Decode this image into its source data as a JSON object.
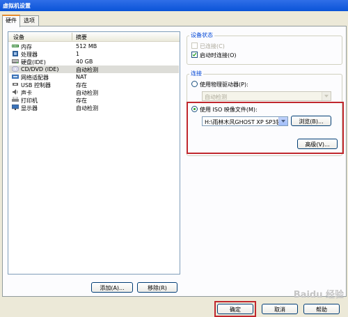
{
  "window": {
    "title": "虚拟机设置"
  },
  "tabs": [
    {
      "label": "硬件",
      "active": true
    },
    {
      "label": "选项",
      "active": false
    }
  ],
  "device_table": {
    "columns": [
      "设备",
      "摘要"
    ],
    "rows": [
      {
        "icon": "memory-icon",
        "name": "内存",
        "summary": "512 MB",
        "selected": false
      },
      {
        "icon": "processor-icon",
        "name": "处理器",
        "summary": "1",
        "selected": false
      },
      {
        "icon": "hard-disk-icon",
        "name": "硬盘(IDE)",
        "summary": "40 GB",
        "selected": false
      },
      {
        "icon": "cd-dvd-icon",
        "name": "CD/DVD (IDE)",
        "summary": "自动检测",
        "selected": true
      },
      {
        "icon": "network-adapter-icon",
        "name": "网络适配器",
        "summary": "NAT",
        "selected": false
      },
      {
        "icon": "usb-icon",
        "name": "USB 控制器",
        "summary": "存在",
        "selected": false
      },
      {
        "icon": "sound-card-icon",
        "name": "声卡",
        "summary": "自动检测",
        "selected": false
      },
      {
        "icon": "printer-icon",
        "name": "打印机",
        "summary": "存在",
        "selected": false
      },
      {
        "icon": "display-icon",
        "name": "显示器",
        "summary": "自动检测",
        "selected": false
      }
    ]
  },
  "list_buttons": {
    "add": "添加(A)...",
    "remove": "移除(R)"
  },
  "device_status": {
    "title": "设备状态",
    "connected": {
      "label": "已连接(C)",
      "checked": false,
      "enabled": false
    },
    "connect_at_power_on": {
      "label": "启动时连接(O)",
      "checked": true,
      "enabled": true
    }
  },
  "connection": {
    "title": "连接",
    "physical_drive": {
      "label": "使用物理驱动器(P):",
      "selected": false,
      "value": "自动检测"
    },
    "iso_image": {
      "label": "使用 ISO 映像文件(M):",
      "selected": true,
      "value": "H:\\雨林木风GHOST XP SP3装"
    },
    "browse": "浏览(B)...",
    "advanced": "高级(V)..."
  },
  "dialog_buttons": {
    "ok": "确定",
    "cancel": "取消",
    "help": "帮助"
  },
  "watermark": "Baidu 经验",
  "colors": {
    "highlight": "#c0272d",
    "group_title": "#0046d5",
    "titlebar": "#0a54d8"
  }
}
